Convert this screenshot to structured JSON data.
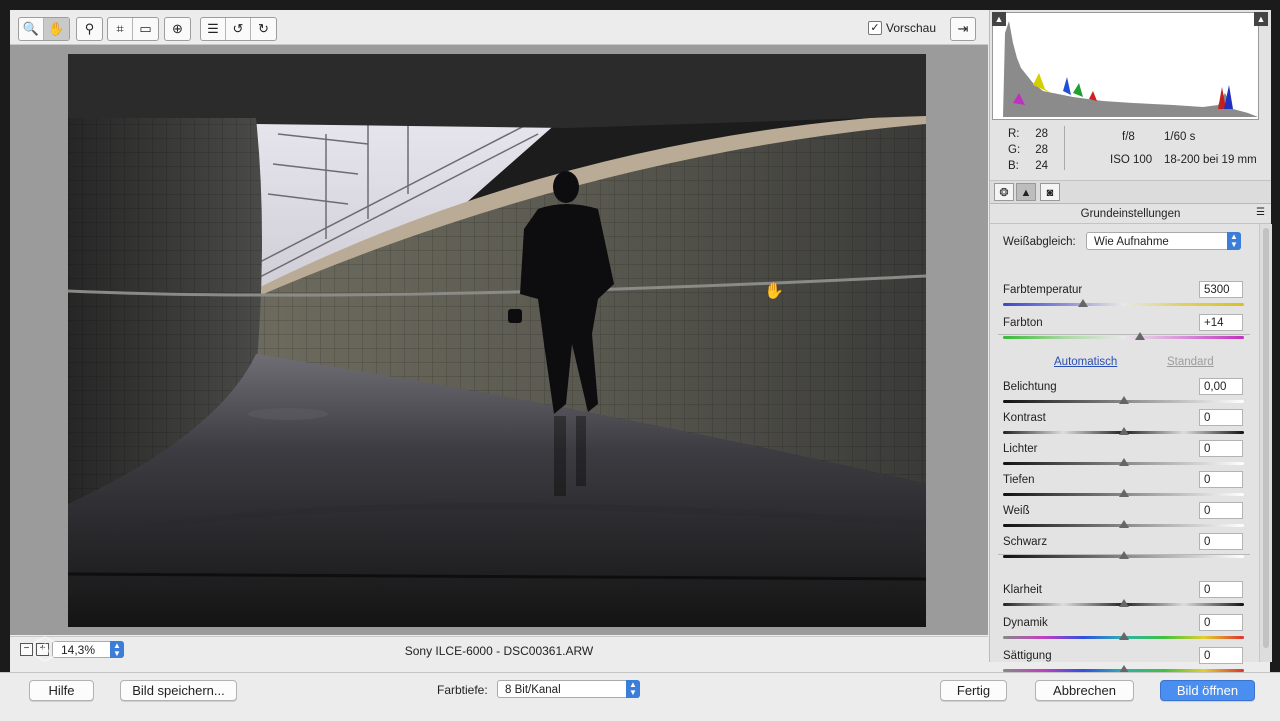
{
  "toolbar": {
    "tools_group1": [
      {
        "name": "zoom-tool",
        "glyph": "🔍",
        "active": false
      },
      {
        "name": "hand-tool",
        "glyph": "✋",
        "active": true
      }
    ],
    "tools_group2": [
      {
        "name": "eyedropper-tool",
        "glyph": "⚲"
      }
    ],
    "tools_group3": [
      {
        "name": "crop-tool",
        "glyph": "⌗"
      },
      {
        "name": "straighten-tool",
        "glyph": "▭"
      }
    ],
    "tools_group4": [
      {
        "name": "redeye-tool",
        "glyph": "⊕"
      }
    ],
    "tools_group5": [
      {
        "name": "preferences-tool",
        "glyph": "☰"
      },
      {
        "name": "rotate-left-tool",
        "glyph": "↺"
      },
      {
        "name": "rotate-right-tool",
        "glyph": "↻"
      }
    ],
    "preview_label": "Vorschau",
    "preview_checked": "✓"
  },
  "status": {
    "zoom_value": "14,3%",
    "filename": "Sony ILCE-6000 - DSC00361.ARW"
  },
  "info": {
    "r_label": "R:",
    "r_value": "28",
    "g_label": "G:",
    "g_value": "28",
    "b_label": "B:",
    "b_value": "24",
    "aperture": "f/8",
    "shutter": "1/60 s",
    "iso": "ISO 100",
    "lens": "18-200 bei 19 mm"
  },
  "panel": {
    "section_title": "Grundeinstellungen",
    "wb_label": "Weißabgleich:",
    "wb_value": "Wie Aufnahme",
    "auto_label": "Automatisch",
    "standard_label": "Standard",
    "sliders": [
      {
        "key": "farbtemperatur",
        "label": "Farbtemperatur",
        "value": "5300",
        "pos": 0.33,
        "track": "temp"
      },
      {
        "key": "farbton",
        "label": "Farbton",
        "value": "+14",
        "pos": 0.57,
        "track": "tint"
      },
      {
        "key": "belichtung",
        "label": "Belichtung",
        "value": "0,00",
        "pos": 0.5,
        "track": "bw"
      },
      {
        "key": "kontrast",
        "label": "Kontrast",
        "value": "0",
        "pos": 0.5,
        "track": "contrast"
      },
      {
        "key": "lichter",
        "label": "Lichter",
        "value": "0",
        "pos": 0.5,
        "track": "bw"
      },
      {
        "key": "tiefen",
        "label": "Tiefen",
        "value": "0",
        "pos": 0.5,
        "track": "bw"
      },
      {
        "key": "weiss",
        "label": "Weiß",
        "value": "0",
        "pos": 0.5,
        "track": "bw"
      },
      {
        "key": "schwarz",
        "label": "Schwarz",
        "value": "0",
        "pos": 0.5,
        "track": "bw"
      },
      {
        "key": "klarheit",
        "label": "Klarheit",
        "value": "0",
        "pos": 0.5,
        "track": "contrast"
      },
      {
        "key": "dynamik",
        "label": "Dynamik",
        "value": "0",
        "pos": 0.5,
        "track": "sat"
      },
      {
        "key": "saettigung",
        "label": "Sättigung",
        "value": "0",
        "pos": 0.5,
        "track": "sat"
      }
    ]
  },
  "footer": {
    "help_label": "Hilfe",
    "save_label": "Bild speichern...",
    "depth_label": "Farbtiefe:",
    "depth_value": "8 Bit/Kanal",
    "done_label": "Fertig",
    "cancel_label": "Abbrechen",
    "open_label": "Bild öffnen"
  },
  "colors": {
    "accent": "#4a8ef0",
    "link": "#2a4fb3"
  }
}
